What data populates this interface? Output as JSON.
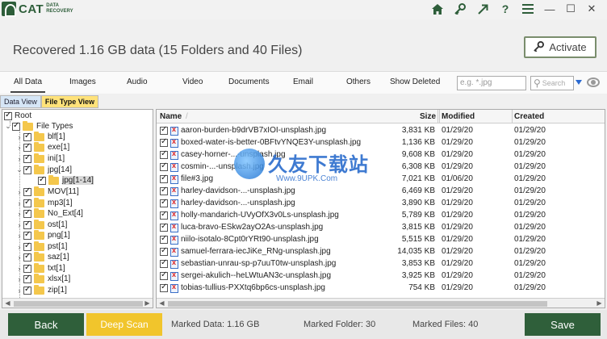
{
  "app": {
    "logo_text": "CAT",
    "logo_sub_1": "DATA",
    "logo_sub_2": "RECOVERY"
  },
  "titlebar_icons": [
    "home-icon",
    "key-icon",
    "share-icon",
    "help-icon",
    "menu-icon",
    "minimize-icon",
    "maximize-icon",
    "close-icon"
  ],
  "titlebar_glyphs": {
    "help": "?",
    "minimize": "—",
    "maximize": "☐",
    "close": "✕"
  },
  "header": {
    "status": "Recovered 1.16 GB data (15 Folders and 40 Files)",
    "activate_label": "Activate"
  },
  "filter_tabs": [
    "All Data",
    "Images",
    "Audio",
    "Video",
    "Documents",
    "Email",
    "Others",
    "Show Deleted"
  ],
  "active_filter": "All Data",
  "search": {
    "placeholder": "e.g. *.jpg",
    "button_label": "Search"
  },
  "view_tabs": {
    "data_view": "Data View",
    "file_type_view": "File Type View",
    "active": "File Type View"
  },
  "tree": {
    "root": "Root",
    "file_types": "File Types",
    "items": [
      "blf[1]",
      "exe[1]",
      "ini[1]",
      "jpg[14]",
      "jpg[1-14]",
      "MOV[11]",
      "mp3[1]",
      "No_Ext[4]",
      "ost[1]",
      "png[1]",
      "pst[1]",
      "saz[1]",
      "txt[1]",
      "xlsx[1]",
      "zip[1]"
    ]
  },
  "file_table": {
    "headers": {
      "name": "Name",
      "size": "Size",
      "modified": "Modified",
      "created": "Created"
    },
    "rows": [
      {
        "name": "aaron-burden-b9drVB7xIOI-unsplash.jpg",
        "size": "3,831 KB",
        "modified": "01/29/20",
        "created": "01/29/20"
      },
      {
        "name": "boxed-water-is-better-0BFtvYNQE3Y-unsplash.jpg",
        "size": "1,136 KB",
        "modified": "01/29/20",
        "created": "01/29/20"
      },
      {
        "name": "casey-horner-...-unsplash.jpg",
        "size": "9,608 KB",
        "modified": "01/29/20",
        "created": "01/29/20"
      },
      {
        "name": "cosmin-...-unsplash.jpg",
        "size": "6,308 KB",
        "modified": "01/29/20",
        "created": "01/29/20"
      },
      {
        "name": "file#3.jpg",
        "size": "7,021 KB",
        "modified": "01/06/20",
        "created": "01/29/20"
      },
      {
        "name": "harley-davidson-...-unsplash.jpg",
        "size": "6,469 KB",
        "modified": "01/29/20",
        "created": "01/29/20"
      },
      {
        "name": "harley-davidson-...-unsplash.jpg",
        "size": "3,890 KB",
        "modified": "01/29/20",
        "created": "01/29/20"
      },
      {
        "name": "holly-mandarich-UVyOfX3v0Ls-unsplash.jpg",
        "size": "5,789 KB",
        "modified": "01/29/20",
        "created": "01/29/20"
      },
      {
        "name": "luca-bravo-ESkw2ayO2As-unsplash.jpg",
        "size": "3,815 KB",
        "modified": "01/29/20",
        "created": "01/29/20"
      },
      {
        "name": "niilo-isotalo-8Cpt0rYRt90-unsplash.jpg",
        "size": "5,515 KB",
        "modified": "01/29/20",
        "created": "01/29/20"
      },
      {
        "name": "samuel-ferrara-iecJiKe_RNg-unsplash.jpg",
        "size": "14,035 KB",
        "modified": "01/29/20",
        "created": "01/29/20"
      },
      {
        "name": "sebastian-unrau-sp-p7uuT0tw-unsplash.jpg",
        "size": "3,853 KB",
        "modified": "01/29/20",
        "created": "01/29/20"
      },
      {
        "name": "sergei-akulich--heLWtuAN3c-unsplash.jpg",
        "size": "3,925 KB",
        "modified": "01/29/20",
        "created": "01/29/20"
      },
      {
        "name": "tobias-tullius-PXXtq6bp6cs-unsplash.jpg",
        "size": "754 KB",
        "modified": "01/29/20",
        "created": "01/29/20"
      }
    ]
  },
  "watermark": {
    "title": "久友下载站",
    "url": "Www.9UPK.Com"
  },
  "bottom": {
    "back_label": "Back",
    "deep_scan_label": "Deep Scan",
    "marked_data": "Marked Data:  1.16 GB",
    "marked_folder": "Marked Folder:  30",
    "marked_files": "Marked Files:  40",
    "save_label": "Save"
  }
}
